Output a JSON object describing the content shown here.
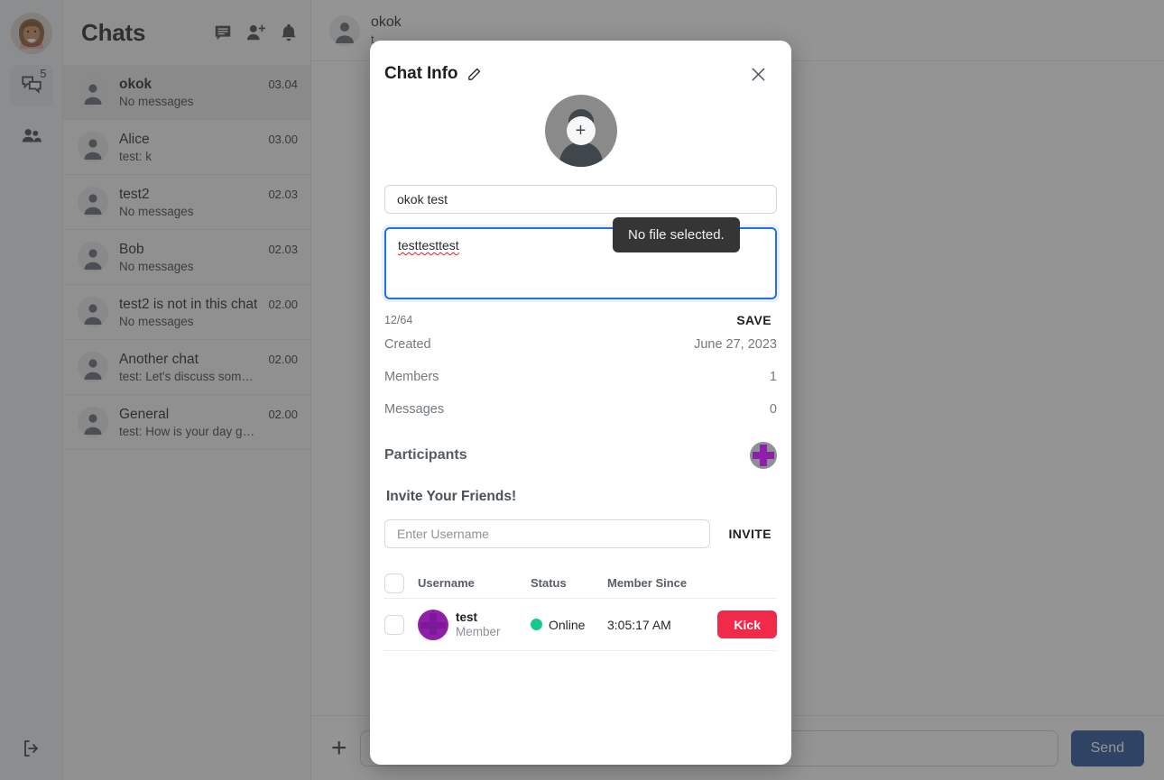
{
  "rail": {
    "avatar_name": "user-avatar",
    "chats_badge": "5",
    "icons": [
      "chat-bubbles-icon",
      "people-icon",
      "logout-icon"
    ]
  },
  "chatlist": {
    "title": "Chats",
    "header_icons": [
      "new-message-icon",
      "add-person-icon",
      "notifications-bell-icon"
    ],
    "items": [
      {
        "name": "okok",
        "preview": "No messages",
        "time": "03.04",
        "selected": true
      },
      {
        "name": "Alice",
        "preview": "test: k",
        "time": "03.00",
        "selected": false
      },
      {
        "name": "test2",
        "preview": "No messages",
        "time": "02.03",
        "selected": false
      },
      {
        "name": "Bob",
        "preview": "No messages",
        "time": "02.03",
        "selected": false
      },
      {
        "name": "test2 is not in this chat",
        "preview": "No messages",
        "time": "02.00",
        "selected": false
      },
      {
        "name": "Another chat",
        "preview": "test: Let's discuss something in…",
        "time": "02.00",
        "selected": false
      },
      {
        "name": "General",
        "preview": "test: How is your day going?",
        "time": "02.00",
        "selected": false
      }
    ]
  },
  "conversation": {
    "title": "okok",
    "subtitle": "t",
    "composer_placeholder": "",
    "send_label": "Send",
    "attach_label": "+"
  },
  "modal": {
    "title": "Chat Info",
    "edit_icon": "pencil-icon",
    "close_icon": "close-icon",
    "avatar_upload_tooltip": "No file selected.",
    "name_value": "okok test",
    "name_placeholder": "",
    "description_value": "testtesttest",
    "description_placeholder": "",
    "char_counter": "12/64",
    "save_label": "SAVE",
    "info": [
      {
        "key": "Created",
        "value": "June 27, 2023"
      },
      {
        "key": "Members",
        "value": "1"
      },
      {
        "key": "Messages",
        "value": "0"
      }
    ],
    "participants_label": "Participants",
    "add_participant_icon": "add-participant-icon",
    "invite_heading": "Invite Your Friends!",
    "invite_placeholder": "Enter Username",
    "invite_value": "",
    "invite_label": "INVITE",
    "table": {
      "columns": [
        "Username",
        "Status",
        "Member Since"
      ],
      "rows": [
        {
          "username": "test",
          "role": "Member",
          "status": "Online",
          "status_color": "#17c98b",
          "member_since": "3:05:17 AM",
          "action_label": "Kick"
        }
      ]
    }
  },
  "colors": {
    "accent_blue": "#1a73e8",
    "send_blue": "#1f4e96",
    "purple": "#8f1fa8",
    "danger_red": "#f02a49",
    "online_green": "#17c98b"
  }
}
